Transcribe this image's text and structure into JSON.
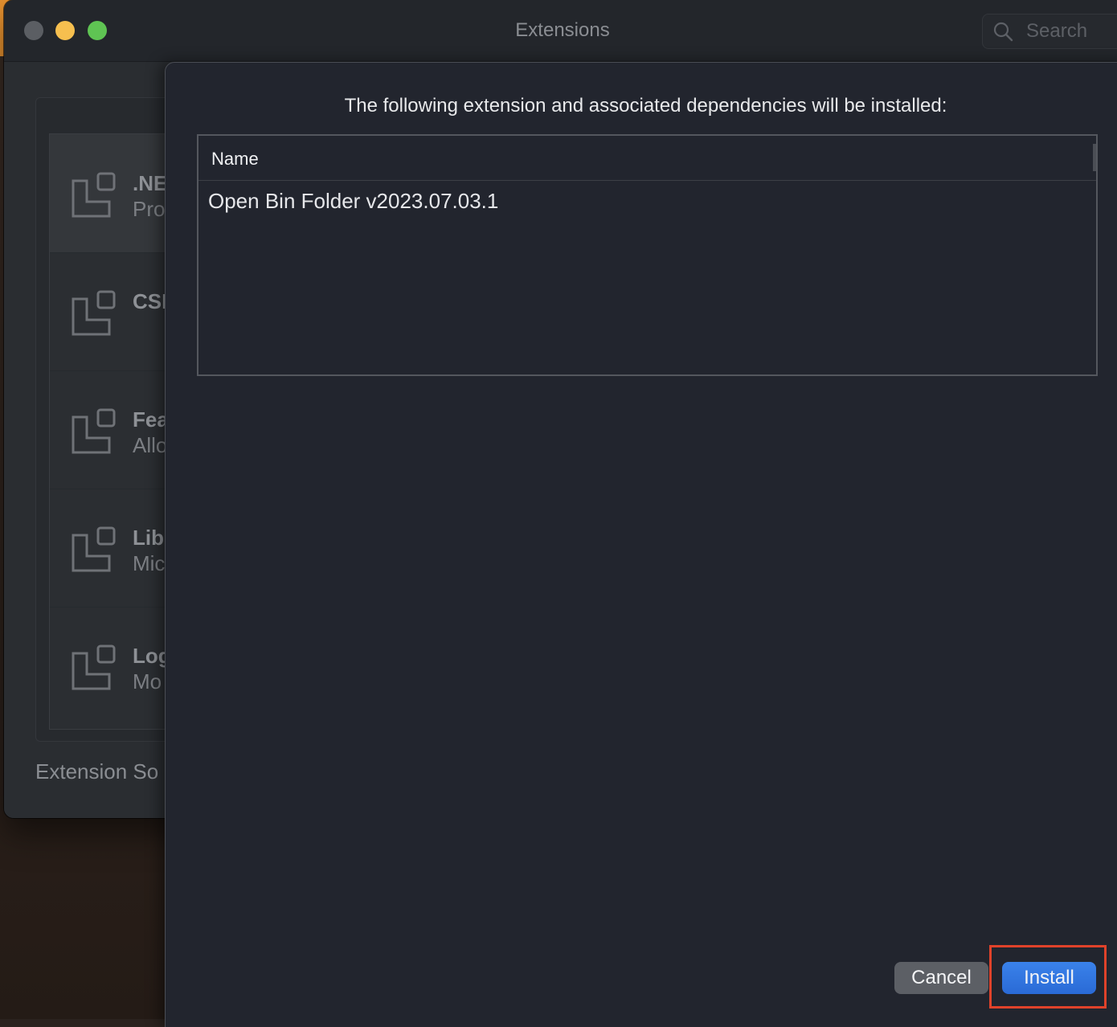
{
  "window": {
    "title": "Extensions",
    "search_placeholder": "Search"
  },
  "extension_list": {
    "items": [
      {
        "title": ".NE",
        "subtitle": "Pro"
      },
      {
        "title": "CSI",
        "subtitle": ""
      },
      {
        "title": "Fea",
        "subtitle": "Allo"
      },
      {
        "title": "Lib",
        "subtitle": "Mic"
      },
      {
        "title": "Log",
        "subtitle": "Mo"
      }
    ],
    "source_label": "Extension So"
  },
  "install_sheet": {
    "message": "The following extension and associated dependencies will be installed:",
    "table": {
      "columns": [
        "Name"
      ],
      "rows": [
        [
          "Open Bin Folder v2023.07.03.1"
        ]
      ]
    },
    "cancel_label": "Cancel",
    "install_label": "Install"
  },
  "colors": {
    "install_button": "#2a6ad6",
    "highlight": "#e0422a"
  }
}
